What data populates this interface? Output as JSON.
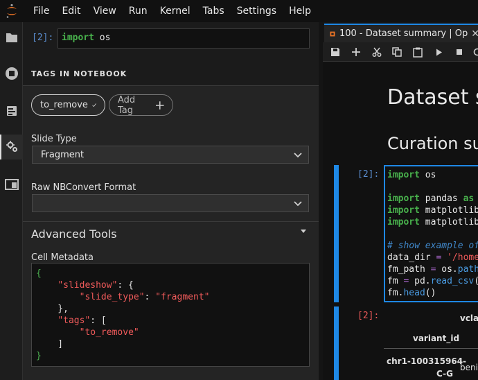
{
  "menubar": {
    "items": [
      "File",
      "Edit",
      "View",
      "Run",
      "Kernel",
      "Tabs",
      "Settings",
      "Help"
    ]
  },
  "activity_icons": [
    "folder-icon",
    "running-icon",
    "commands-icon",
    "property-inspector-icon",
    "tabs-icon"
  ],
  "inspector": {
    "active_cell": {
      "prompt": "[2]:",
      "code_keyword": "import",
      "code_rest": " os"
    },
    "tags_title": "TAGS IN NOTEBOOK",
    "tags": [
      {
        "label": "to_remove",
        "selected": true
      }
    ],
    "add_tag_label": "Add Tag",
    "slide_type_label": "Slide Type",
    "slide_type_value": "Fragment",
    "raw_format_label": "Raw NBConvert Format",
    "raw_format_value": "",
    "advanced_title": "Advanced Tools",
    "metadata_label": "Cell Metadata",
    "metadata": {
      "slideshow_key": "\"slideshow\"",
      "slide_type_key": "\"slide_type\"",
      "slide_type_val": "\"fragment\"",
      "tags_key": "\"tags\"",
      "tag_val": "\"to_remove\""
    }
  },
  "notebook": {
    "tab_title": "100 - Dataset summary | Op",
    "heading1": "Dataset s",
    "heading2": "Curation su",
    "cell2_prompt": "[2]:",
    "cell3_prompt": "[2]:",
    "code": {
      "l1_kw": "import",
      "l1": " os",
      "l2_kw": "import",
      "l2": " pandas ",
      "l2_as": "as",
      "l3_kw": "import",
      "l3": " matplotlib",
      "l4_kw": "import",
      "l4": " matplotlib",
      "l5_comment": "# show example of",
      "l6_a": "data_dir ",
      "l6_eq": "=",
      "l6_str": " '/home",
      "l7_a": "fm_path ",
      "l7_eq": "=",
      "l7_b": " os.",
      "l7_fn": "path",
      "l8_a": "fm ",
      "l8_eq": "=",
      "l8_b": " pd.",
      "l8_fn": "read_csv",
      "l8_c": "(",
      "l9_a": "fm.",
      "l9_fn": "head",
      "l9_c": "()"
    },
    "table": {
      "col_header": "vclas",
      "index_name": "variant_id",
      "row1_index_l1": "chr1-100315964-",
      "row1_index_l2": "C-G",
      "row1_value": "benig"
    }
  }
}
